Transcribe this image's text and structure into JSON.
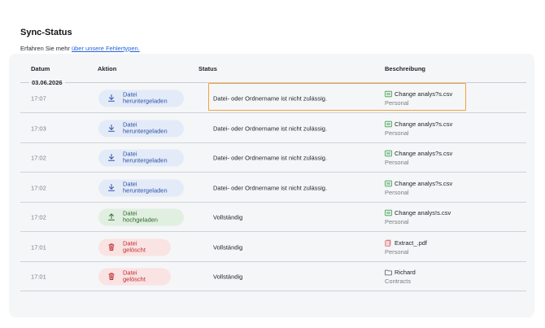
{
  "page": {
    "title": "Sync-Status",
    "subtitle_prefix": "Erfahren Sie mehr ",
    "subtitle_link": "über unsere Fehlertypen."
  },
  "table": {
    "headers": {
      "date": "Datum",
      "action": "Aktion",
      "status": "Status",
      "description": "Beschreibung"
    },
    "date_group": "03.06.2026",
    "rows": [
      {
        "time": "17:07",
        "action": "Datei heruntergeladen",
        "action_type": "download",
        "status": "Datei- oder Ordnername ist nicht zulässig.",
        "file": "Change analys?s.csv",
        "file_icon": "csv-file-icon",
        "location": "Personal"
      },
      {
        "time": "17:03",
        "action": "Datei heruntergeladen",
        "action_type": "download",
        "status": "Datei- oder Ordnername ist nicht zulässig.",
        "file": "Change analys?s.csv",
        "file_icon": "csv-file-icon",
        "location": "Personal"
      },
      {
        "time": "17:02",
        "action": "Datei heruntergeladen",
        "action_type": "download",
        "status": "Datei- oder Ordnername ist nicht zulässig.",
        "file": "Change analys?s.csv",
        "file_icon": "csv-file-icon",
        "location": "Personal"
      },
      {
        "time": "17:02",
        "action": "Datei heruntergeladen",
        "action_type": "download",
        "status": "Datei- oder Ordnername ist nicht zulässig.",
        "file": "Change analys?s.csv",
        "file_icon": "csv-file-icon",
        "location": "Personal"
      },
      {
        "time": "17:02",
        "action": "Datei hochgeladen",
        "action_type": "upload",
        "status": "Vollständig",
        "file": "Change analys!s.csv",
        "file_icon": "csv-file-icon",
        "location": "Personal"
      },
      {
        "time": "17:01",
        "action": "Datei gelöscht",
        "action_type": "delete",
        "status": "Vollständig",
        "file": "Extract_.pdf",
        "file_icon": "pdf-file-icon",
        "location": "Personal"
      },
      {
        "time": "17:01",
        "action": "Datei gelöscht",
        "action_type": "delete",
        "status": "Vollständig",
        "file": "Richard",
        "file_icon": "folder-icon",
        "location": "Contracts"
      }
    ]
  },
  "colors": {
    "download": "#2d51a7",
    "upload": "#2c6b2e",
    "delete": "#bf2d2d",
    "link": "#2563d9",
    "highlight": "#f0a23c"
  }
}
